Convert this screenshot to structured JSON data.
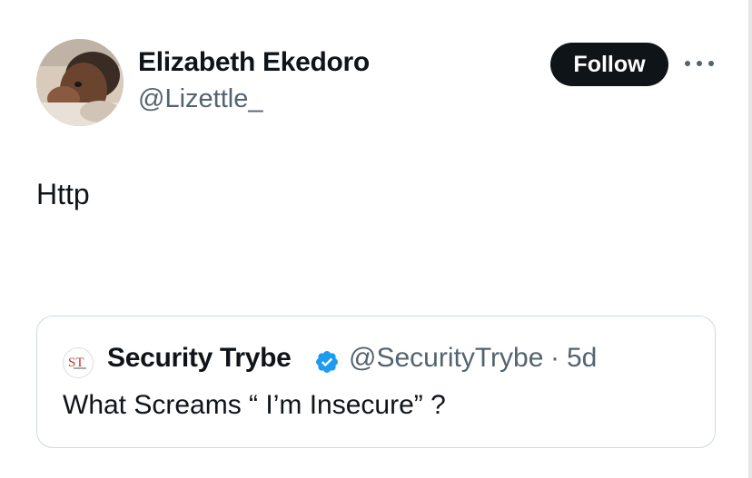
{
  "tweet": {
    "author": {
      "name": "Elizabeth Ekedoro",
      "handle": "@Lizettle_"
    },
    "follow_label": "Follow",
    "more_icon": "more-horizontal-icon",
    "text": "Http"
  },
  "quoted_tweet": {
    "author": {
      "name": "Security Trybe",
      "handle": "@SecurityTrybe",
      "avatar_text": "ST",
      "verified": true
    },
    "separator": "·",
    "time": "5d",
    "text": "What Screams “ I’m Insecure” ?"
  },
  "colors": {
    "text_primary": "#0f1419",
    "text_secondary": "#536471",
    "follow_bg": "#0f1419",
    "verified_blue": "#1d9bf0",
    "card_border": "#cfd9de"
  }
}
